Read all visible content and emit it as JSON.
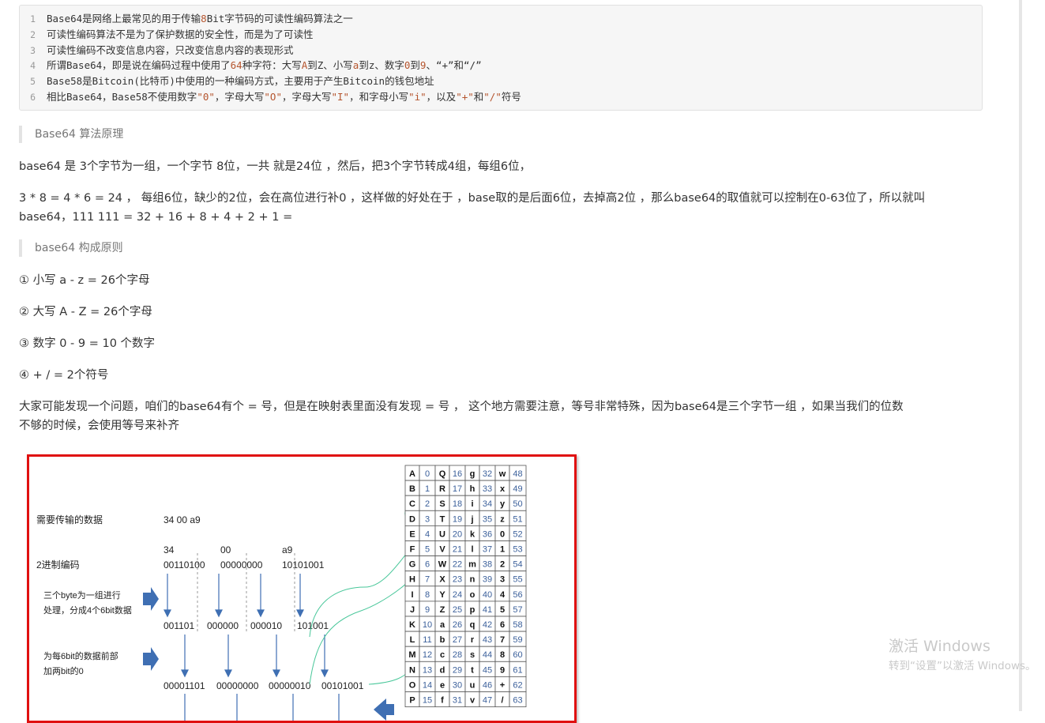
{
  "code_block": {
    "lines": [
      {
        "n": "1",
        "segments": [
          {
            "t": "Base64是网络上最常见的用于传输"
          },
          {
            "t": "8",
            "c": "num"
          },
          {
            "t": "Bit字节码的可读性编码算法之一"
          }
        ]
      },
      {
        "n": "2",
        "segments": [
          {
            "t": "可读性编码算法不是为了保护数据的安全性，而是为了可读性"
          }
        ]
      },
      {
        "n": "3",
        "segments": [
          {
            "t": "可读性编码不改变信息内容，只改变信息内容的表现形式"
          }
        ]
      },
      {
        "n": "4",
        "segments": [
          {
            "t": "所谓Base64，即是说在编码过程中使用了"
          },
          {
            "t": "64",
            "c": "num"
          },
          {
            "t": "种字符：大写"
          },
          {
            "t": "A",
            "c": "num"
          },
          {
            "t": "到Z、小写"
          },
          {
            "t": "a",
            "c": "num"
          },
          {
            "t": "到z、数字"
          },
          {
            "t": "0",
            "c": "num"
          },
          {
            "t": "到"
          },
          {
            "t": "9",
            "c": "num"
          },
          {
            "t": "、“+”和“/”"
          }
        ]
      },
      {
        "n": "5",
        "segments": [
          {
            "t": "Base58是Bitcoin(比特币)中使用的一种编码方式，主要用于产生Bitcoin的钱包地址"
          }
        ]
      },
      {
        "n": "6",
        "segments": [
          {
            "t": "相比Base64，Base58不使用数字"
          },
          {
            "t": "\"0\"",
            "c": "str"
          },
          {
            "t": "，字母大写"
          },
          {
            "t": "\"O\"",
            "c": "str"
          },
          {
            "t": "，字母大写"
          },
          {
            "t": "\"I\"",
            "c": "str"
          },
          {
            "t": "，和字母小写"
          },
          {
            "t": "\"i\"",
            "c": "str"
          },
          {
            "t": "，以及"
          },
          {
            "t": "\"+\"",
            "c": "str"
          },
          {
            "t": "和"
          },
          {
            "t": "\"/\"",
            "c": "str"
          },
          {
            "t": "符号"
          }
        ]
      }
    ]
  },
  "section1": {
    "heading": "Base64 算法原理"
  },
  "para1": "base64 是 3个字节为一组，一个字节 8位，一共 就是24位 ，然后，把3个字节转成4组，每组6位，",
  "para2_line1": "3 * 8 = 4 * 6 = 24 ， 每组6位，缺少的2位，会在高位进行补0 ，这样做的好处在于 ，base取的是后面6位，去掉高2位 ，那么base64的取值就可以控制在0-63位了，所以就叫",
  "para2_line2": "base64，111 111 = 32 + 16 + 8 + 4 + 2 + 1 =",
  "section2": {
    "heading": "base64 构成原则"
  },
  "rules": [
    "① 小写 a - z = 26个字母",
    "② 大写 A - Z = 26个字母",
    "③ 数字 0 - 9 = 10 个数字",
    "④ + / = 2个符号"
  ],
  "para3_line1": "大家可能发现一个问题，咱们的base64有个 = 号，但是在映射表里面没有发现 = 号 ， 这个地方需要注意，等号非常特殊，因为base64是三个字节一组 ，如果当我们的位数",
  "para3_line2": "不够的时候，会使用等号来补齐",
  "figure": {
    "label_data": "需要传输的数据",
    "data_value": "34 00 a9",
    "label_binary": "2进制编码",
    "hex_bytes": [
      "34",
      "00",
      "a9"
    ],
    "binary_bytes": [
      "00110100",
      "00000000",
      "10101001"
    ],
    "step1_line1": "三个byte为一组进行",
    "step1_line2": "处理，分成4个6bit数据",
    "six_bit": [
      "001101",
      "000000",
      "000010",
      "101001"
    ],
    "step2_line1": "为每6bit的数据前部",
    "step2_line2": "加两bit的0",
    "eight_bit": [
      "00001101",
      "00000000",
      "00000010",
      "00101001"
    ],
    "table": {
      "rows": [
        [
          "A",
          "0",
          "Q",
          "16",
          "g",
          "32",
          "w",
          "48"
        ],
        [
          "B",
          "1",
          "R",
          "17",
          "h",
          "33",
          "x",
          "49"
        ],
        [
          "C",
          "2",
          "S",
          "18",
          "i",
          "34",
          "y",
          "50"
        ],
        [
          "D",
          "3",
          "T",
          "19",
          "j",
          "35",
          "z",
          "51"
        ],
        [
          "E",
          "4",
          "U",
          "20",
          "k",
          "36",
          "0",
          "52"
        ],
        [
          "F",
          "5",
          "V",
          "21",
          "l",
          "37",
          "1",
          "53"
        ],
        [
          "G",
          "6",
          "W",
          "22",
          "m",
          "38",
          "2",
          "54"
        ],
        [
          "H",
          "7",
          "X",
          "23",
          "n",
          "39",
          "3",
          "55"
        ],
        [
          "I",
          "8",
          "Y",
          "24",
          "o",
          "40",
          "4",
          "56"
        ],
        [
          "J",
          "9",
          "Z",
          "25",
          "p",
          "41",
          "5",
          "57"
        ],
        [
          "K",
          "10",
          "a",
          "26",
          "q",
          "42",
          "6",
          "58"
        ],
        [
          "L",
          "11",
          "b",
          "27",
          "r",
          "43",
          "7",
          "59"
        ],
        [
          "M",
          "12",
          "c",
          "28",
          "s",
          "44",
          "8",
          "60"
        ],
        [
          "N",
          "13",
          "d",
          "29",
          "t",
          "45",
          "9",
          "61"
        ],
        [
          "O",
          "14",
          "e",
          "30",
          "u",
          "46",
          "+",
          "62"
        ],
        [
          "P",
          "15",
          "f",
          "31",
          "v",
          "47",
          "/",
          "63"
        ]
      ]
    }
  },
  "watermark": {
    "title": "激活 Windows",
    "subtitle": "转到“设置”以激活 Windows。"
  },
  "colors": {
    "accent_red": "#e01010",
    "arrow_blue": "#3f6fb3",
    "link_green": "#49c79a"
  }
}
